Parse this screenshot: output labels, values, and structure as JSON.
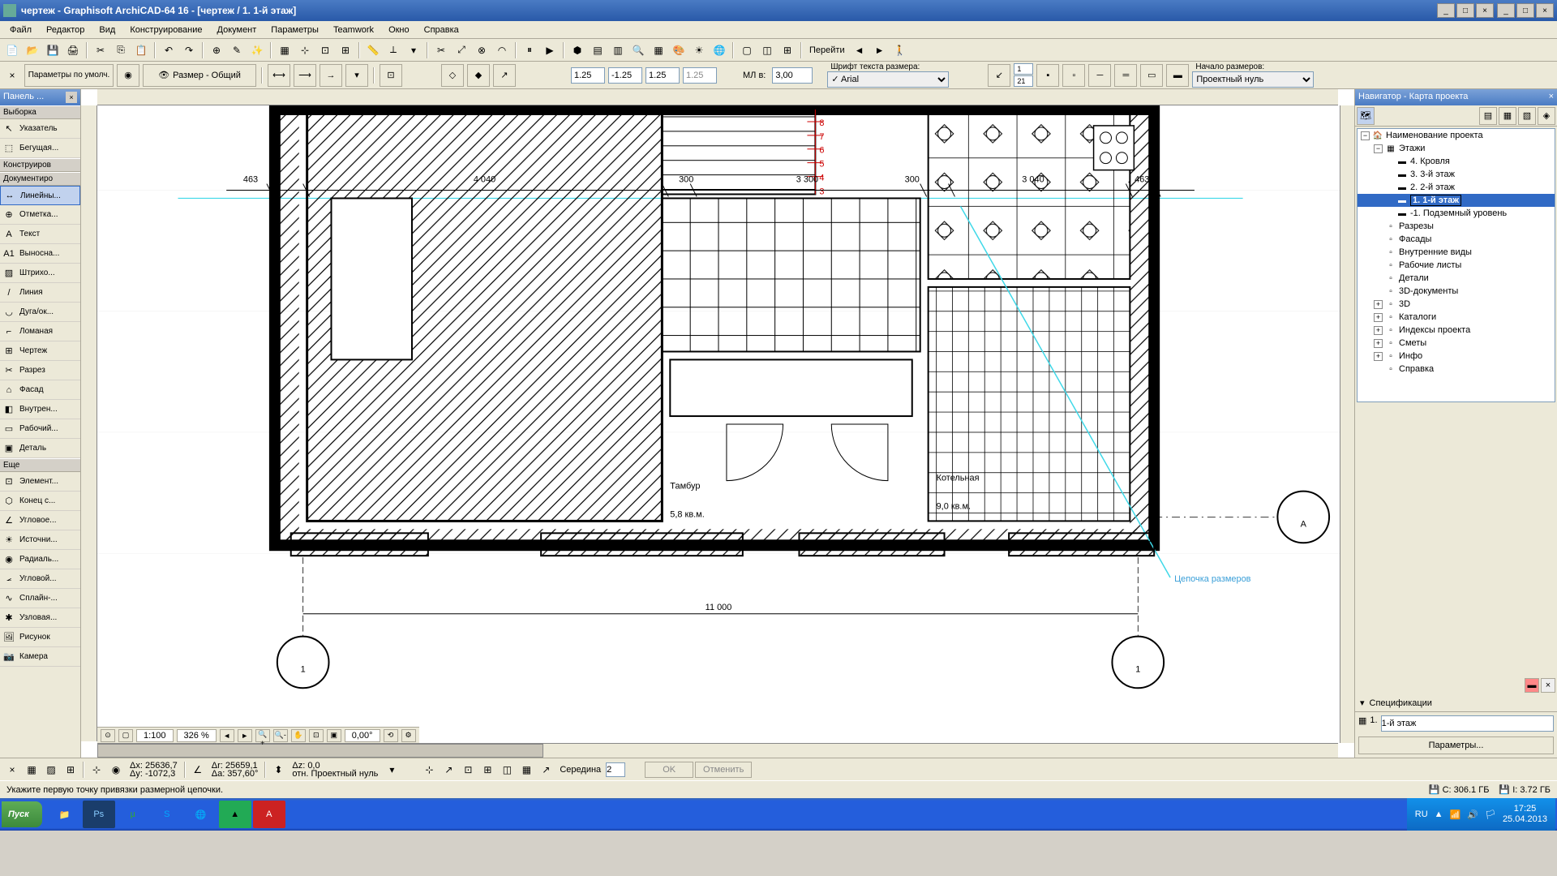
{
  "title": "чертеж - Graphisoft ArchiCAD-64 16 - [чертеж / 1. 1-й этаж]",
  "menu": [
    "Файл",
    "Редактор",
    "Вид",
    "Конструирование",
    "Документ",
    "Параметры",
    "Teamwork",
    "Окно",
    "Справка"
  ],
  "toolbar2": {
    "params_label": "Параметры по умолч.",
    "layer": "Размер - Общий",
    "dim1": "1.25",
    "dim2": "-1.25",
    "dim3": "1.25",
    "dim4": "1.25",
    "scale_label": "МЛ в:",
    "scale_val": "3,00",
    "font_label": "Шрифт текста размера:",
    "font_val": "Arial",
    "f1": "1",
    "f2": "21",
    "origin_label": "Начало размеров:",
    "origin_val": "Проектный нуль",
    "goto": "Перейти"
  },
  "toolbox": {
    "title": "Панель ...",
    "sections": {
      "sel": "Выборка",
      "con": "Конструиров",
      "doc": "Документиро",
      "more": "Еще"
    },
    "sel_tools": [
      {
        "i": "↖",
        "l": "Указатель"
      },
      {
        "i": "⬚",
        "l": "Бегущая..."
      }
    ],
    "doc_tools": [
      {
        "i": "↔",
        "l": "Линейны..."
      },
      {
        "i": "⊕",
        "l": "Отметка..."
      },
      {
        "i": "A",
        "l": "Текст"
      },
      {
        "i": "A1",
        "l": "Выносна..."
      },
      {
        "i": "▨",
        "l": "Штрихо..."
      },
      {
        "i": "/",
        "l": "Линия"
      },
      {
        "i": "◡",
        "l": "Дуга/ок..."
      },
      {
        "i": "⌐",
        "l": "Ломаная"
      },
      {
        "i": "⊞",
        "l": "Чертеж"
      },
      {
        "i": "✂",
        "l": "Разрез"
      },
      {
        "i": "⌂",
        "l": "Фасад"
      },
      {
        "i": "◧",
        "l": "Внутрен..."
      },
      {
        "i": "▭",
        "l": "Рабочий..."
      },
      {
        "i": "▣",
        "l": "Деталь"
      }
    ],
    "more_tools": [
      {
        "i": "⊡",
        "l": "Элемент..."
      },
      {
        "i": "⬡",
        "l": "Конец с..."
      },
      {
        "i": "∠",
        "l": "Угловое..."
      },
      {
        "i": "☀",
        "l": "Источни..."
      },
      {
        "i": "◉",
        "l": "Радиаль..."
      },
      {
        "i": "⦟",
        "l": "Угловой..."
      },
      {
        "i": "∿",
        "l": "Сплайн-..."
      },
      {
        "i": "✱",
        "l": "Узловая..."
      },
      {
        "i": "🖼",
        "l": "Рисунок"
      },
      {
        "i": "📷",
        "l": "Камера"
      }
    ]
  },
  "drawing": {
    "dims_top": [
      "463",
      "4 040",
      "300",
      "3 300",
      "300",
      "3 040",
      "463"
    ],
    "dim_bottom": "11 000",
    "room1_name": "Тамбур",
    "room1_area": "5,8 кв.м.",
    "room2_name": "Котельная",
    "room2_area": "9,0 кв.м.",
    "axis_a": "А",
    "axis_1": "1",
    "annotation": "Цепочка размеров",
    "red_nums": [
      "8",
      "7",
      "6",
      "5",
      "4",
      "3"
    ]
  },
  "navigator": {
    "title": "Навигатор - Карта проекта",
    "root": "Наименование проекта",
    "floors_label": "Этажи",
    "floors": [
      "4. Кровля",
      "3. 3-й этаж",
      "2. 2-й этаж",
      "1. 1-й этаж",
      "-1. Подземный уровень"
    ],
    "items": [
      "Разрезы",
      "Фасады",
      "Внутренние виды",
      "Рабочие листы",
      "Детали",
      "3D-документы",
      "3D",
      "Каталоги",
      "Индексы проекта",
      "Сметы",
      "Инфо",
      "Справка"
    ],
    "spec_label": "Спецификации",
    "spec_num": "1.",
    "spec_val": "1-й этаж",
    "params_btn": "Параметры..."
  },
  "zoombar": {
    "scale": "1:100",
    "zoom": "326 %",
    "angle": "0,00°"
  },
  "coords": {
    "dx": "Δx: 25636,7",
    "dy": "Δy: -1072,3",
    "dr": "Δr: 25659,1",
    "da": "Δa: 357,60°",
    "dz": "Δz: 0,0",
    "ref": "отн. Проектный нуль",
    "mid": "Середина",
    "ok": "OK",
    "cancel": "Отменить"
  },
  "hint": "Укажите первую точку привязки размерной цепочки.",
  "disk": {
    "c": "C: 306.1 ГБ",
    "i": "I: 3.72 ГБ"
  },
  "taskbar": {
    "start": "Пуск",
    "lang": "RU",
    "time": "17:25",
    "date": "25.04.2013"
  }
}
